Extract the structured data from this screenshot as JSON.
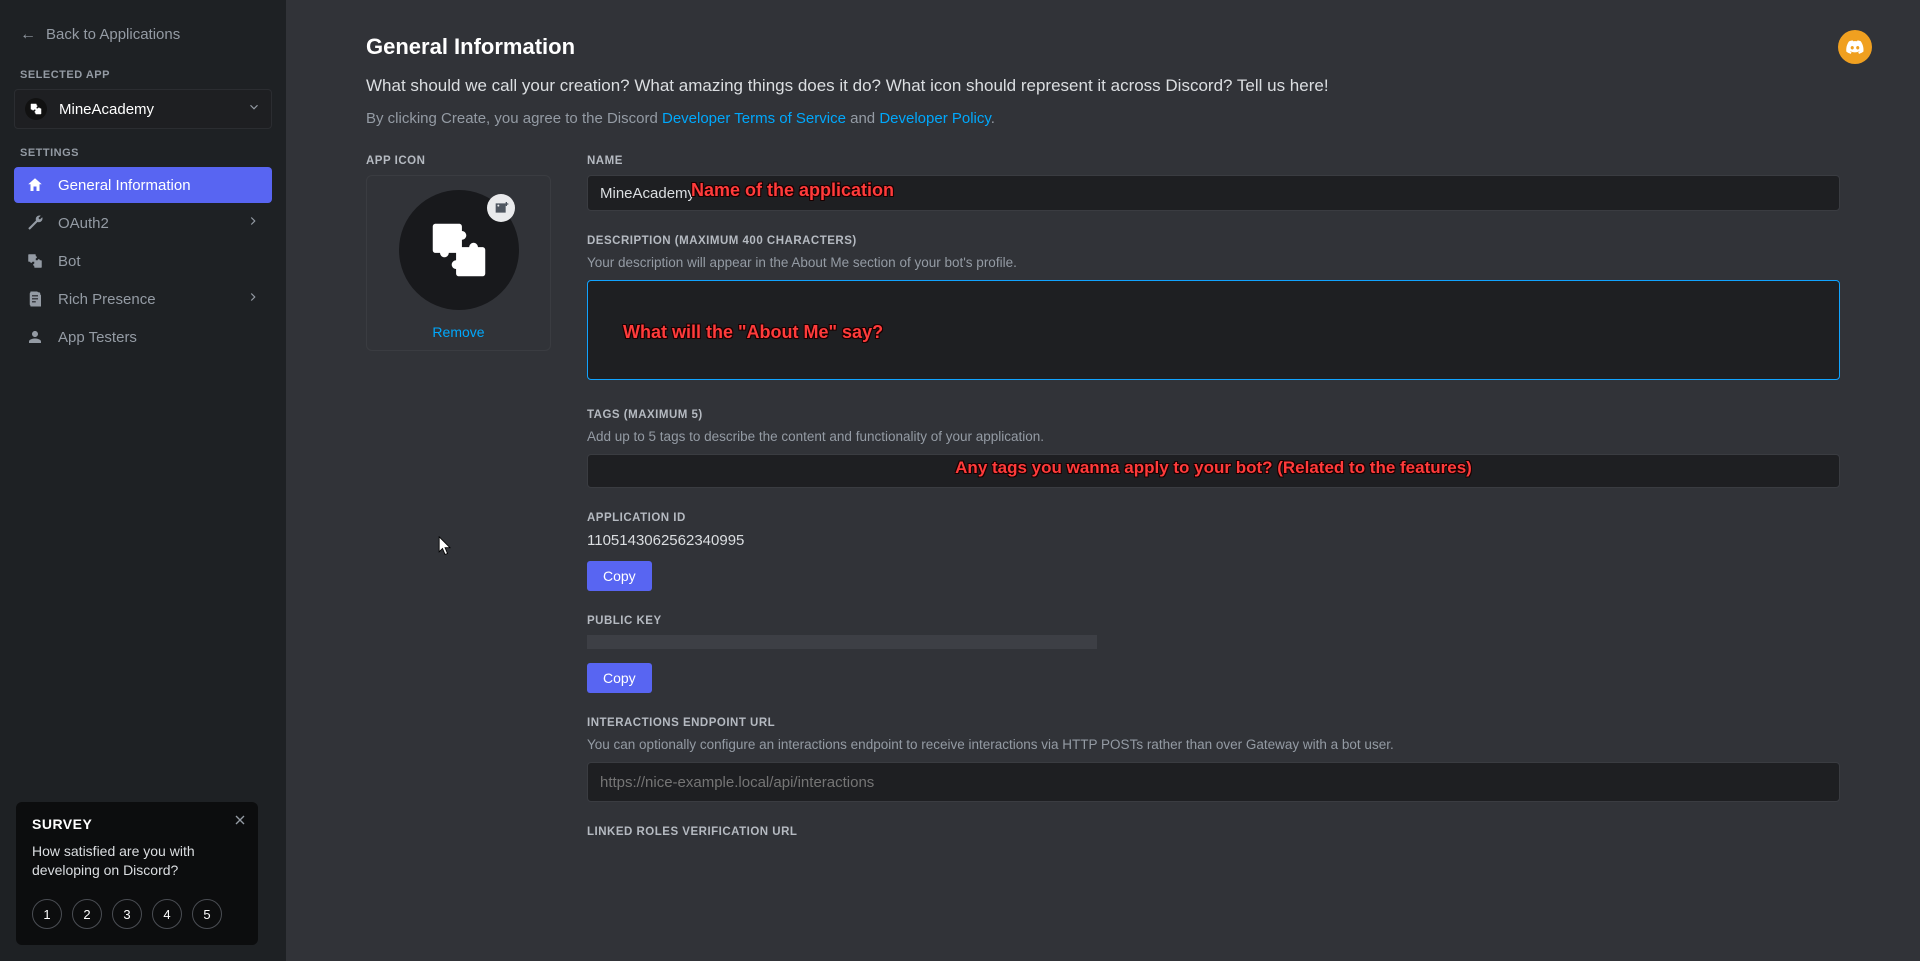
{
  "back_link": "Back to Applications",
  "selected_app_label": "SELECTED APP",
  "selected_app_name": "MineAcademy",
  "settings_label": "SETTINGS",
  "nav": {
    "general": "General Information",
    "oauth2": "OAuth2",
    "bot": "Bot",
    "rich_presence": "Rich Presence",
    "app_testers": "App Testers"
  },
  "page_title": "General Information",
  "intro": "What should we call your creation? What amazing things does it do? What icon should represent it across Discord? Tell us here!",
  "tos_prefix": "By clicking Create, you agree to the Discord ",
  "tos_link_1": "Developer Terms of Service",
  "tos_mid": " and ",
  "tos_link_2": "Developer Policy",
  "tos_suffix": ".",
  "labels": {
    "app_icon": "APP ICON",
    "name": "NAME",
    "description": "DESCRIPTION (MAXIMUM 400 CHARACTERS)",
    "description_help": "Your description will appear in the About Me section of your bot's profile.",
    "tags": "TAGS (MAXIMUM 5)",
    "tags_help": "Add up to 5 tags to describe the content and functionality of your application.",
    "application_id": "APPLICATION ID",
    "public_key": "PUBLIC KEY",
    "interactions": "INTERACTIONS ENDPOINT URL",
    "interactions_help": "You can optionally configure an interactions endpoint to receive interactions via HTTP POSTs rather than over Gateway with a bot user.",
    "linked_roles": "LINKED ROLES VERIFICATION URL"
  },
  "values": {
    "name": "MineAcademy",
    "application_id": "1105143062562340995",
    "interactions_placeholder": "https://nice-example.local/api/interactions"
  },
  "remove_link": "Remove",
  "copy_label": "Copy",
  "annotations": {
    "name": "Name of the application",
    "description": "What will the \"About Me\" say?",
    "tags": "Any tags you wanna apply to your bot? (Related to the features)"
  },
  "survey": {
    "title": "SURVEY",
    "text": "How satisfied are you with developing on Discord?",
    "scale": [
      "1",
      "2",
      "3",
      "4",
      "5"
    ]
  }
}
